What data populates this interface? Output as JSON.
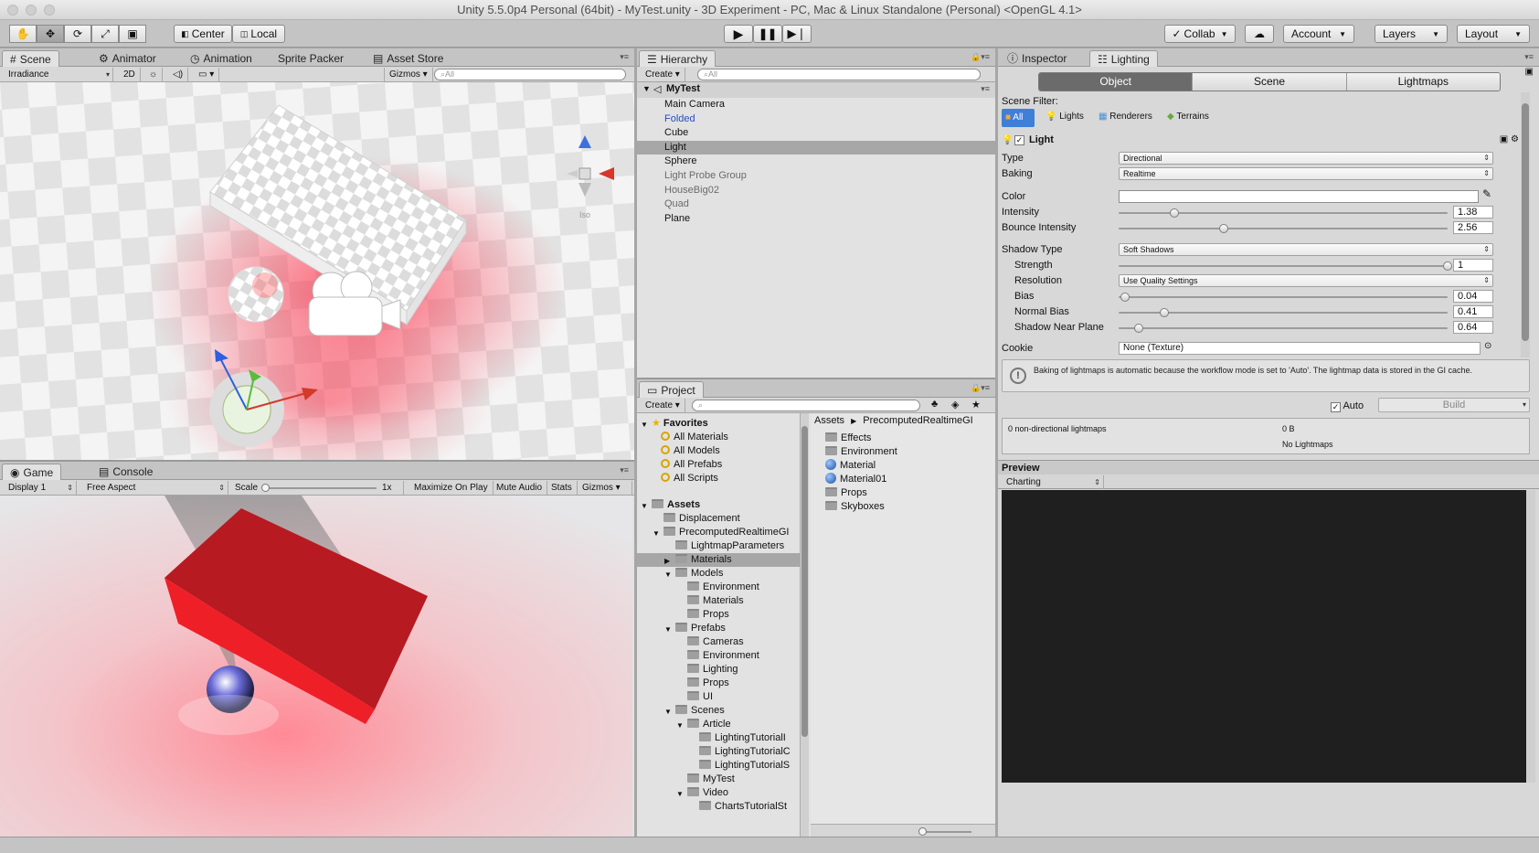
{
  "window": {
    "title": "Unity 5.5.0p4 Personal (64bit) - MyTest.unity - 3D Experiment - PC, Mac & Linux Standalone (Personal) <OpenGL 4.1>"
  },
  "toolbar": {
    "center": "Center",
    "local": "Local",
    "collab": "Collab",
    "account": "Account",
    "layers": "Layers",
    "layout": "Layout"
  },
  "scene": {
    "tabs": [
      "Scene",
      "Animator",
      "Animation",
      "Sprite Packer",
      "Asset Store"
    ],
    "draw_mode": "Irradiance",
    "mode_2d": "2D",
    "gizmos": "Gizmos",
    "search": "All",
    "iso": "Iso"
  },
  "game": {
    "tabs": [
      "Game",
      "Console"
    ],
    "display": "Display 1",
    "aspect": "Free Aspect",
    "scale_label": "Scale",
    "scale_value": "1x",
    "buttons": [
      "Maximize On Play",
      "Mute Audio",
      "Stats",
      "Gizmos"
    ]
  },
  "hierarchy": {
    "tab": "Hierarchy",
    "create": "Create",
    "search": "All",
    "scene": "MyTest",
    "items": [
      "Main Camera",
      "Folded",
      "Cube",
      "Light",
      "Sphere",
      "Light Probe Group",
      "HouseBig02",
      "Quad",
      "Plane"
    ]
  },
  "project": {
    "tab": "Project",
    "create": "Create",
    "favorites": {
      "label": "Favorites",
      "items": [
        "All Materials",
        "All Models",
        "All Prefabs",
        "All Scripts"
      ]
    },
    "assets_label": "Assets",
    "tree": [
      [
        "Displacement",
        1
      ],
      [
        "PrecomputedRealtimeGI",
        1
      ],
      [
        "LightmapParameters",
        2
      ],
      [
        "Materials",
        2
      ],
      [
        "Models",
        2
      ],
      [
        "Environment",
        3
      ],
      [
        "Materials",
        3
      ],
      [
        "Props",
        3
      ],
      [
        "Prefabs",
        2
      ],
      [
        "Cameras",
        3
      ],
      [
        "Environment",
        3
      ],
      [
        "Lighting",
        3
      ],
      [
        "Props",
        3
      ],
      [
        "UI",
        3
      ],
      [
        "Scenes",
        2
      ],
      [
        "Article",
        3
      ],
      [
        "LightingTutorialI",
        4
      ],
      [
        "LightingTutorialC",
        4
      ],
      [
        "LightingTutorialS",
        4
      ],
      [
        "MyTest",
        3
      ],
      [
        "Video",
        3
      ],
      [
        "ChartsTutorialSt",
        4
      ]
    ],
    "breadcrumb": [
      "Assets",
      "PrecomputedRealtimeGI"
    ],
    "contents": [
      "Effects",
      "Environment",
      "Material",
      "Material01",
      "Props",
      "Skyboxes"
    ]
  },
  "inspector": {
    "tabs": [
      "Inspector",
      "Lighting"
    ],
    "modes": [
      "Object",
      "Scene",
      "Lightmaps"
    ],
    "scene_filter": "Scene Filter:",
    "filters": [
      "All",
      "Lights",
      "Renderers",
      "Terrains"
    ],
    "component": "Light",
    "type_label": "Type",
    "type_value": "Directional",
    "baking_label": "Baking",
    "baking_value": "Realtime",
    "color_label": "Color",
    "intensity_label": "Intensity",
    "intensity_value": "1.38",
    "bounce_label": "Bounce Intensity",
    "bounce_value": "2.56",
    "shadow_type_label": "Shadow Type",
    "shadow_type_value": "Soft Shadows",
    "strength_label": "Strength",
    "strength_value": "1",
    "resolution_label": "Resolution",
    "resolution_value": "Use Quality Settings",
    "bias_label": "Bias",
    "bias_value": "0.04",
    "normal_bias_label": "Normal Bias",
    "normal_bias_value": "0.41",
    "near_plane_label": "Shadow Near Plane",
    "near_plane_value": "0.64",
    "cookie_label": "Cookie",
    "cookie_value": "None (Texture)",
    "info": "Baking of lightmaps is automatic because the workflow mode is set to 'Auto'. The lightmap data is stored in the GI cache.",
    "auto_label": "Auto",
    "build_label": "Build",
    "stats_left": "0 non-directional lightmaps",
    "stats_size": "0 B",
    "stats_right": "No Lightmaps",
    "preview_label": "Preview",
    "preview_mode": "Charting",
    "slider_levels": {
      "intensity": 0.17,
      "bounce": 0.32,
      "strength": 1.0,
      "bias": 0.02,
      "normal_bias": 0.14,
      "near_plane": 0.06
    }
  },
  "colors": {
    "accent": "#3d7bd8",
    "selected": "#3f89dd",
    "cube_red": "#d81b20"
  }
}
